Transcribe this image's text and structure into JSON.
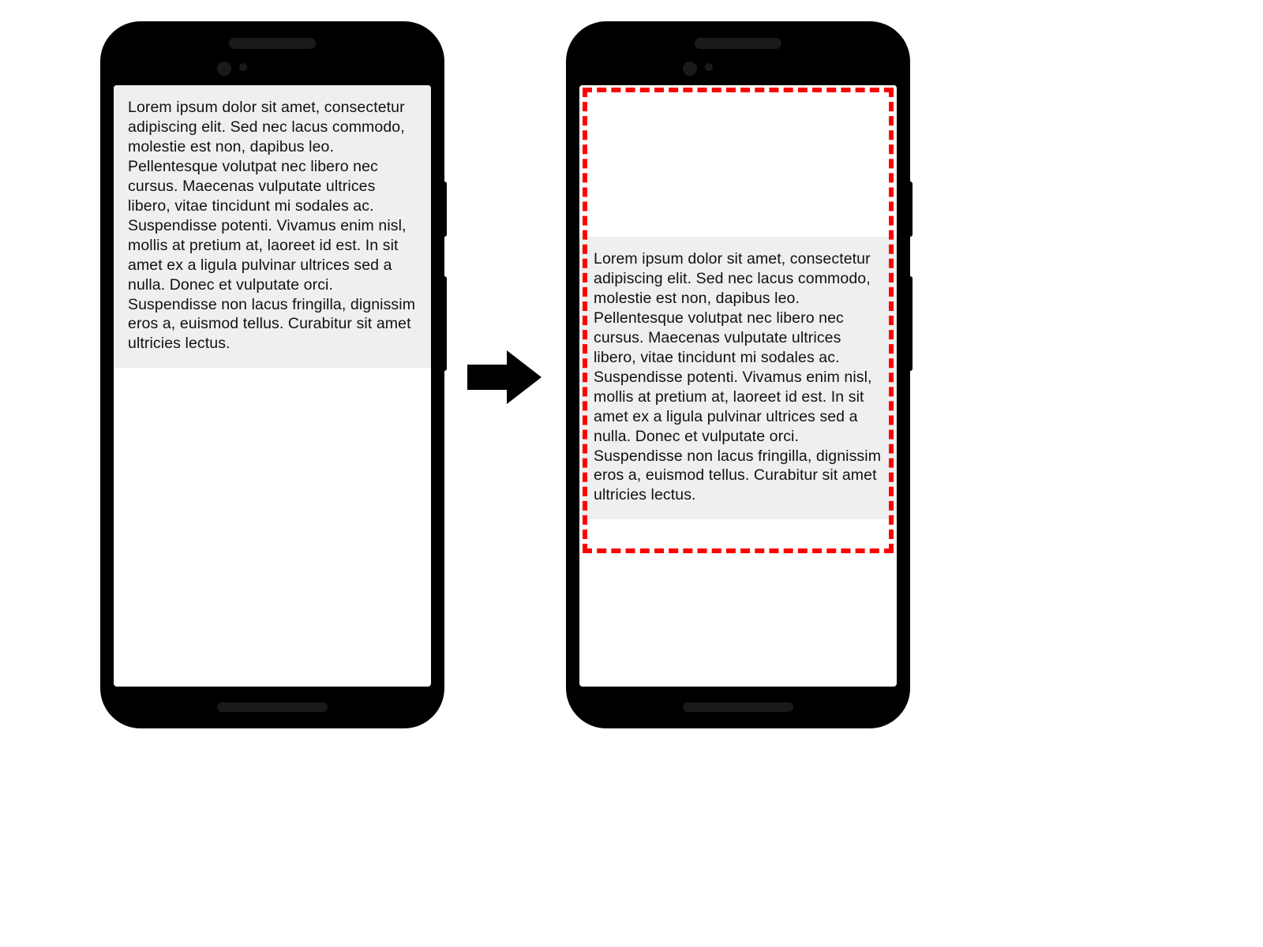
{
  "lorem_text": "Lorem ipsum dolor sit amet, consectetur adipiscing elit. Sed nec lacus commodo, molestie est non, dapibus leo. Pellentesque volutpat nec libero nec cursus. Maecenas vulputate ultrices libero, vitae tincidunt mi sodales ac. Suspendisse potenti. Vivamus enim nisl, mollis at pretium at, laoreet id est. In sit amet ex a ligula pulvinar ultrices sed a nulla. Donec et vulputate orci. Suspendisse non lacus fringilla, dignissim eros a, euismod tellus. Curabitur sit amet ultricies lectus.",
  "colors": {
    "text_block_bg": "#efefef",
    "highlight_border": "#ff0000",
    "phone_body": "#000000"
  }
}
